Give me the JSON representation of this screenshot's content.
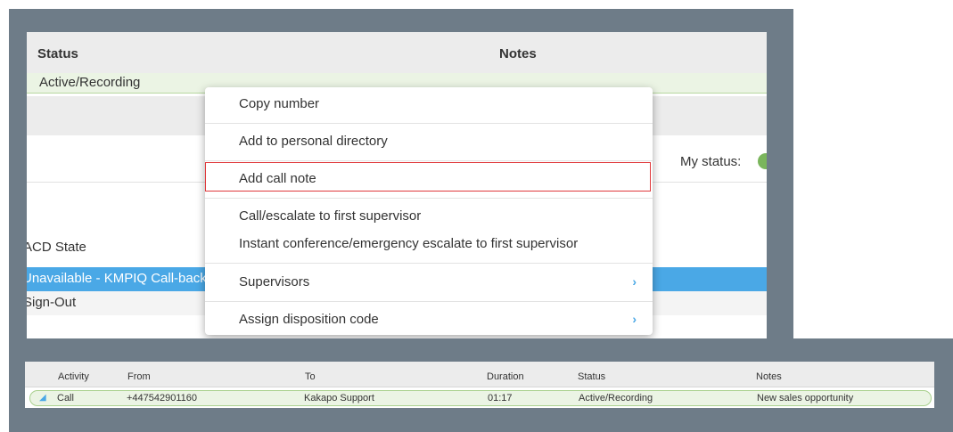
{
  "top_table": {
    "headers": {
      "status": "Status",
      "notes": "Notes"
    },
    "row_status": "Active/Recording"
  },
  "my_status_label": "My status:",
  "acd": {
    "label": "ACD State",
    "selected": "Unavailable - KMPIQ Call-back",
    "signout": "Sign-Out"
  },
  "context_menu": {
    "items": [
      "Copy number",
      "Add to personal directory",
      "Add call note",
      "Call/escalate to first supervisor",
      "Instant conference/emergency escalate to first supervisor",
      "Supervisors",
      "Assign disposition code"
    ],
    "highlighted_item": "Add call note",
    "submenu_arrow": "›"
  },
  "bottom_table": {
    "headers": {
      "activity": "Activity",
      "from": "From",
      "to": "To",
      "duration": "Duration",
      "status": "Status",
      "notes": "Notes"
    },
    "row": {
      "activity": "Call",
      "from": "+447542901160",
      "to": "Kakapo Support",
      "duration": "01:17",
      "status": "Active/Recording",
      "notes": "New sales opportunity"
    }
  },
  "icons": {
    "call": "phone-wave-icon",
    "status": "status-dot-icon",
    "submenu": "chevron-right-icon"
  },
  "colors": {
    "accent_blue": "#4aa8e6",
    "active_green_bg": "#ebf4e4",
    "highlight_red": "#e0383b",
    "backdrop": "#6e7c88"
  }
}
